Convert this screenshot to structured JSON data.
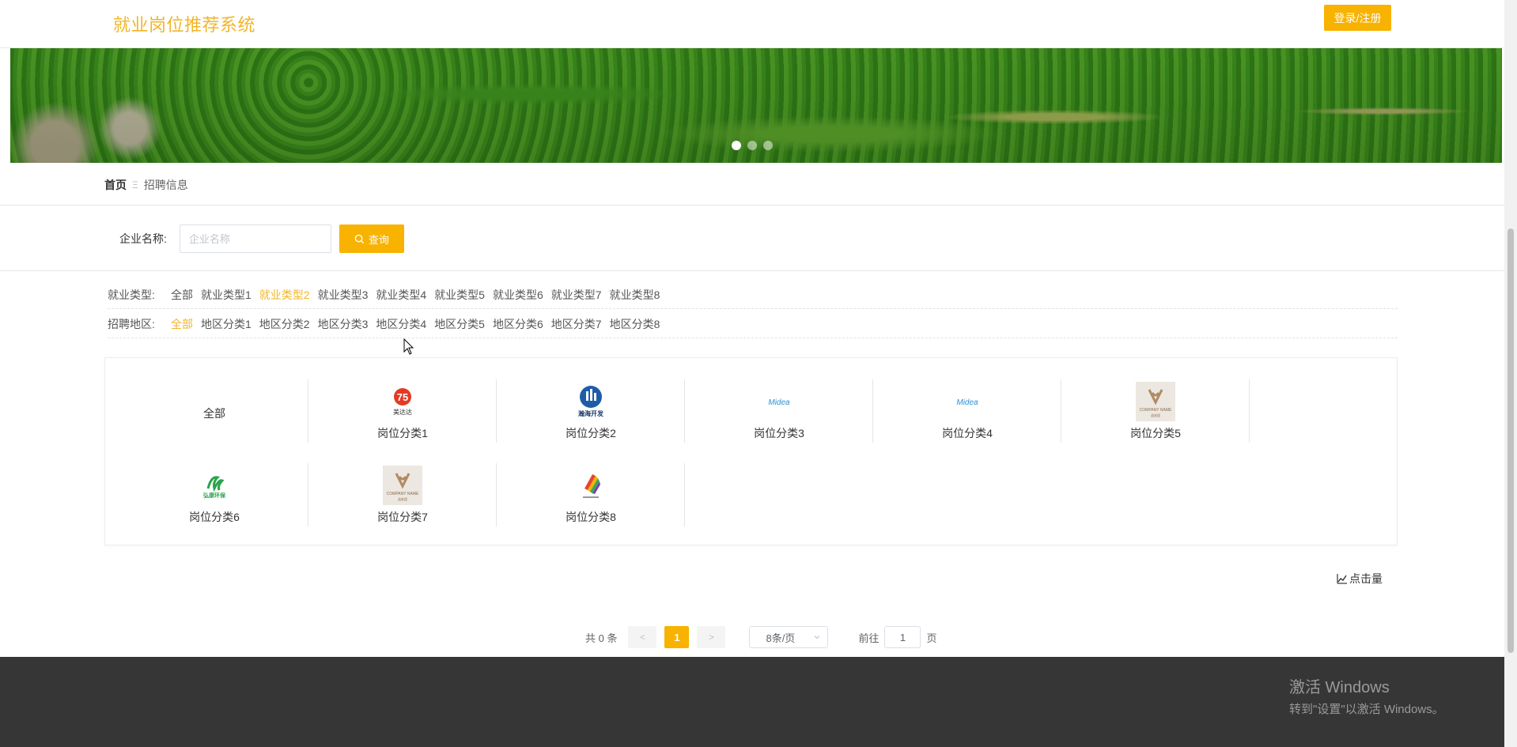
{
  "header": {
    "title": "就业岗位推荐系统",
    "login_label": "登录/注册"
  },
  "banner": {
    "image": "tropical-forest-banner",
    "slides": 3,
    "active_slide": 1
  },
  "breadcrumb": {
    "home": "首页",
    "separator": "Ξ",
    "current": "招聘信息"
  },
  "search": {
    "label": "企业名称:",
    "placeholder": "企业名称",
    "value": "",
    "button_label": "查询",
    "button_icon": "search-icon"
  },
  "filters": [
    {
      "label": "就业类型:",
      "options": [
        "全部",
        "就业类型1",
        "就业类型2",
        "就业类型3",
        "就业类型4",
        "就业类型5",
        "就业类型6",
        "就业类型7",
        "就业类型8"
      ],
      "active_index": 2
    },
    {
      "label": "招聘地区:",
      "options": [
        "全部",
        "地区分类1",
        "地区分类2",
        "地区分类3",
        "地区分类4",
        "地区分类5",
        "地区分类6",
        "地区分类7",
        "地区分类8"
      ],
      "active_index": 0
    }
  ],
  "categories": [
    {
      "name": "全部",
      "logo": ""
    },
    {
      "name": "岗位分类1",
      "logo": "meidada-logo-icon"
    },
    {
      "name": "岗位分类2",
      "logo": "haohai-logo-icon"
    },
    {
      "name": "岗位分类3",
      "logo": "midea-logo-icon"
    },
    {
      "name": "岗位分类4",
      "logo": "midea-logo-icon"
    },
    {
      "name": "岗位分类5",
      "logo": "company-name-logo-icon"
    },
    {
      "name": "岗位分类6",
      "logo": "green-logo-icon"
    },
    {
      "name": "岗位分类7",
      "logo": "company-name-logo-icon"
    },
    {
      "name": "岗位分类8",
      "logo": "colorful-logo-icon"
    }
  ],
  "logo_text": {
    "meidada": "美达达",
    "haohai": "瀚海开发",
    "midea": "Midea",
    "company_name": "COMPANY NAME",
    "company_sub": "益安居",
    "green": "弘康环保"
  },
  "sort": {
    "label": "点击量",
    "icon": "chart-icon"
  },
  "pagination": {
    "total": "共 0 条",
    "prev": "<",
    "current_page": "1",
    "next": ">",
    "page_size": "8条/页",
    "goto_label": "前往",
    "goto_value": "1",
    "goto_suffix": "页"
  },
  "watermark": {
    "line1": "激活 Windows",
    "line2": "转到\"设置\"以激活 Windows。"
  },
  "colors": {
    "accent": "#f8b200",
    "title": "#f3b526",
    "footer": "#363636"
  }
}
